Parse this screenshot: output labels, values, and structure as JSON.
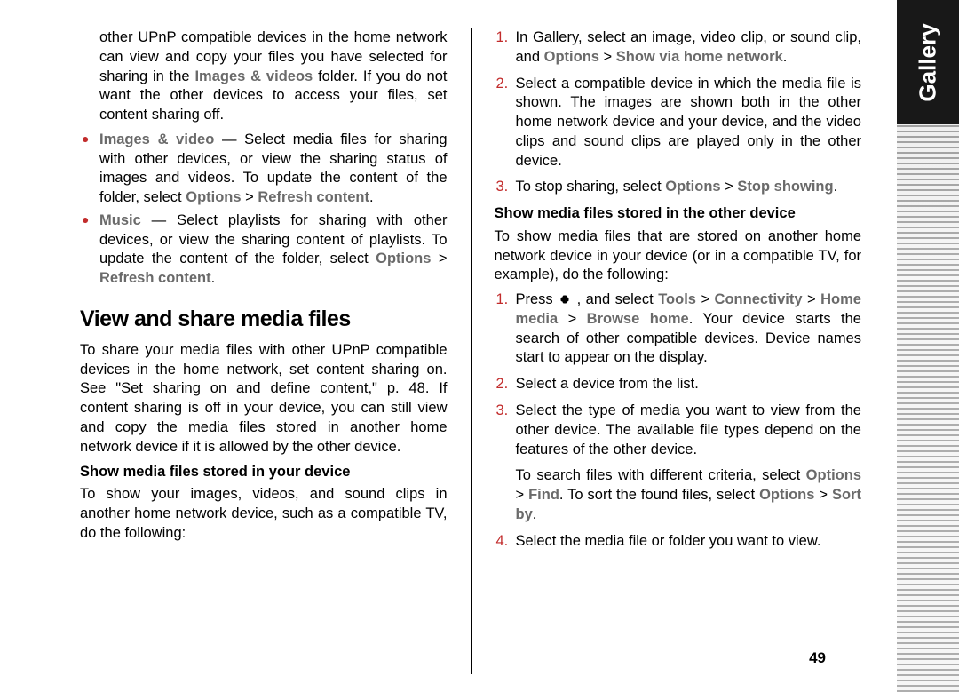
{
  "side_label": "Gallery",
  "page_number": "49",
  "left": {
    "intro_para": [
      "other UPnP compatible devices in the home network can view and copy your files you have selected for sharing in the ",
      "Images & videos",
      " folder. If you do not want the other devices to access your files, set content sharing off."
    ],
    "bullets": [
      {
        "lead": "Images & video",
        "body": " — Select media files for sharing with other devices, or view the sharing status of images and videos. To update the content of the folder, select ",
        "opt1": "Options",
        "gt1": " > ",
        "opt2": "Refresh content",
        "end": "."
      },
      {
        "lead": "Music",
        "body": " — Select playlists for sharing with other devices, or view the sharing content of playlists. To update the content of the folder, select ",
        "opt1": "Options",
        "gt1": " > ",
        "opt2": "Refresh content",
        "end": "."
      }
    ],
    "heading": "View and share media files",
    "para2a": "To share your media files with other UPnP compatible devices in the home network, set content sharing on. ",
    "link": "See \"Set sharing on and define content,\" p. 48.",
    "para2b": " If content sharing is off in your device, you can still view and copy the media files stored in another home network device if it is allowed by the other device.",
    "sub1": "Show media files stored in your device",
    "para3": "To show your images, videos, and sound clips in another home network device, such as a compatible TV, do the following:"
  },
  "right": {
    "steps_a": [
      {
        "n": "1.",
        "parts": [
          "In Gallery, select an image, video clip, or sound clip, and ",
          "Options",
          " > ",
          "Show via home network",
          "."
        ]
      },
      {
        "n": "2.",
        "parts": [
          "Select a compatible device in which the media file is shown. The images are shown both in the other home network device and your device, and the video clips and sound clips are played only in the other device."
        ]
      },
      {
        "n": "3.",
        "parts": [
          "To stop sharing, select ",
          "Options",
          " > ",
          "Stop showing",
          "."
        ]
      }
    ],
    "sub2": "Show media files stored in the other device",
    "para4": "To show media files that are stored on another home network device in your device (or in a compatible TV, for example), do the following:",
    "steps_b": [
      {
        "n": "1.",
        "parts_before": "Press ",
        "parts_after": [
          " , and select ",
          "Tools",
          " > ",
          "Connectivity",
          " > ",
          "Home media",
          " > ",
          "Browse home",
          ". Your device starts the search of other compatible devices. Device names start to appear on the display."
        ]
      },
      {
        "n": "2.",
        "text": "Select a device from the list."
      },
      {
        "n": "3.",
        "text": "Select the type of media you want to view from the other device. The available file types depend on the features of the other device."
      },
      {
        "n": "4.",
        "text": "Select the media file or folder you want to view."
      }
    ],
    "search_para": [
      "To search files with different criteria, select ",
      "Options",
      " > ",
      "Find",
      ". To sort the found files, select ",
      "Options",
      " > ",
      "Sort by",
      "."
    ]
  }
}
